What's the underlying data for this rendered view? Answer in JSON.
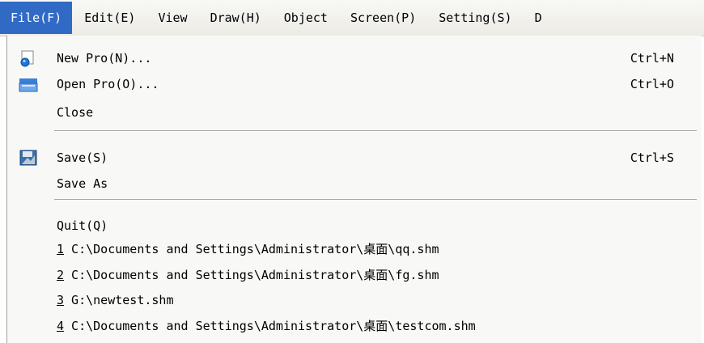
{
  "menubar": {
    "items": [
      {
        "label": "File(F)",
        "active": true
      },
      {
        "label": "Edit(E)"
      },
      {
        "label": "View"
      },
      {
        "label": "Draw(H)"
      },
      {
        "label": "Object"
      },
      {
        "label": "Screen(P)"
      },
      {
        "label": "Setting(S)"
      },
      {
        "label": "D"
      }
    ]
  },
  "file_menu": {
    "new_pro": {
      "label": "New Pro(N)...",
      "shortcut": "Ctrl+N",
      "icon": "new-document-icon"
    },
    "open_pro": {
      "label": "Open Pro(O)...",
      "shortcut": "Ctrl+O",
      "icon": "open-folder-icon"
    },
    "close": {
      "label": "Close"
    },
    "save": {
      "label": "Save(S)",
      "shortcut": "Ctrl+S",
      "icon": "save-icon"
    },
    "save_as": {
      "label": "Save As"
    },
    "quit": {
      "label": "Quit(Q)"
    },
    "recent": [
      {
        "num": "1",
        "path": " C:\\Documents and Settings\\Administrator\\桌面\\qq.shm"
      },
      {
        "num": "2",
        "path": " C:\\Documents and Settings\\Administrator\\桌面\\fg.shm"
      },
      {
        "num": "3",
        "path": " G:\\newtest.shm"
      },
      {
        "num": "4",
        "path": " C:\\Documents and Settings\\Administrator\\桌面\\testcom.shm"
      }
    ]
  },
  "colors": {
    "highlight": "#316ac5",
    "menu_bg": "#f8f8f6"
  }
}
